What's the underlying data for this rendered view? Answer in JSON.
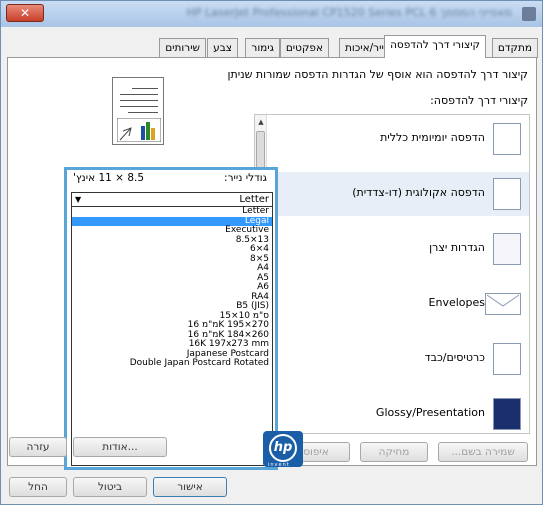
{
  "window": {
    "title": "HP LaserJet Professional CP1520 Series PCL 6 מאפייני המסמך",
    "close_glyph": "✕"
  },
  "tabs": [
    "מתקדם",
    "קיצורי דרך להדפסה",
    "נייר/איכות",
    "אפקטים",
    "גימור",
    "צבע",
    "שירותים"
  ],
  "active_tab": "קיצורי דרך להדפסה",
  "panel": {
    "description": "קיצור דרך להדפסה הוא אוסף של הגדרות הדפסה שמורות שניתן",
    "list_title": "קיצורי דרך להדפסה:",
    "shortcuts": [
      {
        "label": "הדפסה יומיומית כללית",
        "icon": "document-icon"
      },
      {
        "label": "הדפסה אקולוגית (דו-צדדית)",
        "icon": "duplex-document-icon"
      },
      {
        "label": "הגדרות יצרן",
        "icon": "blank-page-icon"
      },
      {
        "label": "Envelopes",
        "icon": "envelope-icon"
      },
      {
        "label": "כרטיסים/כבד",
        "icon": "card-icon"
      },
      {
        "label": "Glossy/Presentation",
        "icon": "presentation-icon"
      }
    ],
    "buttons": {
      "save_as": "שמירה בשם...",
      "delete": "מחיקה",
      "reset": "איפוס"
    },
    "paper": {
      "label": "גודלי נייר:",
      "size_text": "8.5 × 11 אינץ'",
      "selected": "Letter",
      "highlighted": "Legal",
      "options": [
        "Letter",
        "Legal",
        "Executive",
        "8.5×13",
        "6×4",
        "8×5",
        "A4",
        "A5",
        "A6",
        "RA4",
        "B5 (JIS)",
        "ס\"מ 10×15",
        "מ\"מ 16K 195×270",
        "מ\"מ 16K 184×260",
        "16K 197x273 mm",
        "Japanese Postcard",
        "Double Japan Postcard Rotated"
      ]
    }
  },
  "footer": {
    "about": "אודות...",
    "help": "עזרה",
    "ok": "אישור",
    "cancel": "ביטול",
    "apply": "החל"
  },
  "logo": {
    "mark": "hp",
    "tagline": "invent"
  }
}
